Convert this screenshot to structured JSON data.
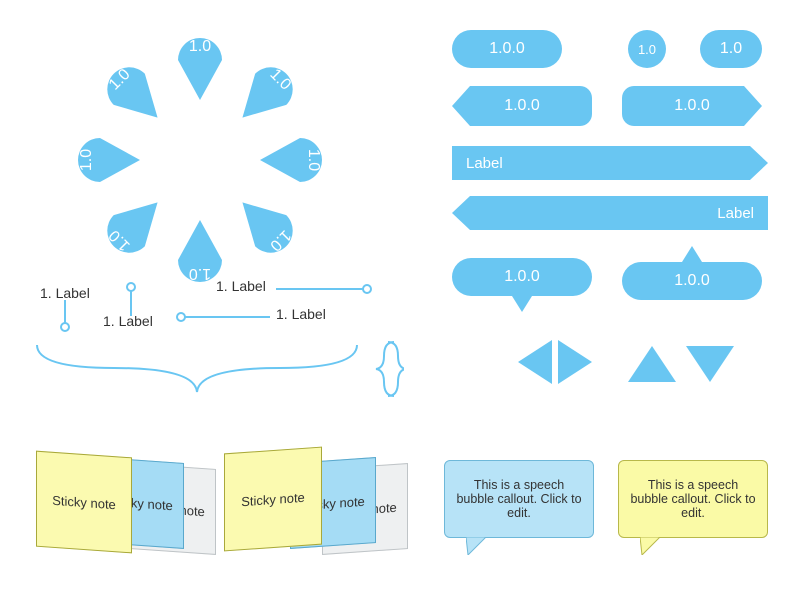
{
  "petals": {
    "label": "1.0"
  },
  "markers": {
    "l1": "1. Label",
    "l2": "1. Label",
    "l3": "1. Label",
    "l4": "1. Label"
  },
  "badges": {
    "pill1": "1.0.0",
    "pill2": "1.0",
    "pill3": "1.0",
    "arrowL": "1.0.0",
    "arrowR": "1.0.0",
    "bar1": "Label",
    "bar2": "Label",
    "callout1": "1.0.0",
    "callout2": "1.0.0"
  },
  "sticky": {
    "front": "Sticky note",
    "mid": "Sticky note",
    "back": "Sticky note",
    "front2": "Sticky note",
    "mid2": "Sticky note",
    "back2": "Sticky note"
  },
  "speech": {
    "blue": "This is a speech bubble callout. Click to edit.",
    "yellow": "This is a speech bubble callout. Click to edit."
  },
  "colors": {
    "accent": "#69c6f2",
    "yellow": "#fbfab0",
    "grey": "#eef0f1"
  }
}
